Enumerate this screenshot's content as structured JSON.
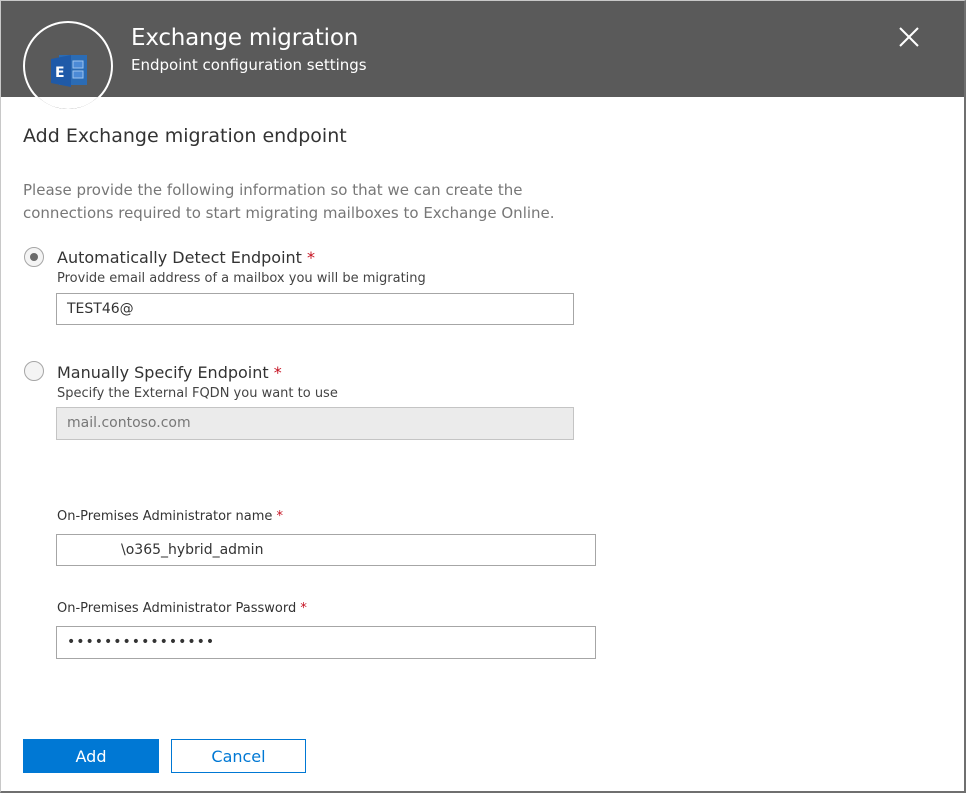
{
  "header": {
    "title": "Exchange migration",
    "subtitle": "Endpoint configuration settings",
    "logo_icon": "exchange-logo-icon",
    "close_icon": "close-icon"
  },
  "form": {
    "section_title": "Add Exchange migration endpoint",
    "intro": "Please provide the following information so that we can create the connections required to start migrating mailboxes to Exchange Online.",
    "auto_detect": {
      "label": "Automatically Detect Endpoint",
      "required": "*",
      "help": "Provide email address of a mailbox you will be migrating",
      "value": "TEST46@",
      "selected": true
    },
    "manual": {
      "label": "Manually Specify Endpoint",
      "required": "*",
      "help": "Specify the External FQDN you want to use",
      "placeholder": "mail.contoso.com",
      "selected": false
    },
    "admin_name": {
      "label": "On-Premises Administrator name",
      "required": "*",
      "value": "\\o365_hybrid_admin"
    },
    "admin_password": {
      "label": "On-Premises Administrator Password",
      "required": "*",
      "value": "••••••••••••••••"
    }
  },
  "buttons": {
    "add": "Add",
    "cancel": "Cancel"
  },
  "colors": {
    "header_bg": "#5a5a5a",
    "accent": "#0078d4",
    "required": "#c50f1f"
  }
}
